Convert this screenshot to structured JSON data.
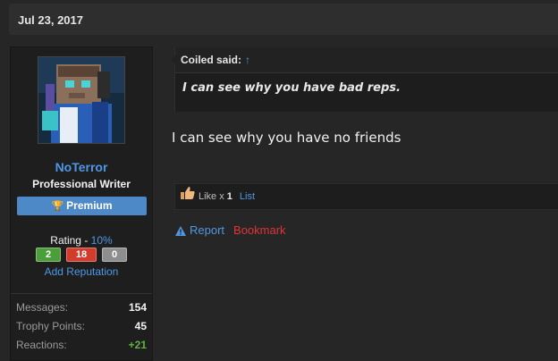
{
  "post": {
    "date": "Jul 23, 2017"
  },
  "author": {
    "username": "NoTerror",
    "title": "Professional Writer",
    "badge_label": "Premium",
    "rating_label": "Rating - ",
    "rating_percent": "10%",
    "rep_positive": "2",
    "rep_negative": "18",
    "rep_neutral": "0",
    "add_reputation": "Add Reputation",
    "stats": [
      {
        "label": "Messages:",
        "value": "154"
      },
      {
        "label": "Trophy Points:",
        "value": "45"
      },
      {
        "label": "Reactions:",
        "value": "+21"
      }
    ]
  },
  "quote": {
    "author_label": "Coiled said:",
    "arrow": "↑",
    "text": "I can see why you have bad reps."
  },
  "message": {
    "text": "I can see why you have no friends"
  },
  "likes": {
    "like_text": "Like x ",
    "count": "1",
    "list_label": "List"
  },
  "actions": {
    "report": "Report",
    "bookmark": "Bookmark"
  },
  "colors": {
    "accent": "#4f97e6",
    "premium": "#4d89c6",
    "positive": "#4c9e3b",
    "negative": "#d23c2d",
    "bookmark": "#e03434"
  },
  "icons": {
    "badge": "trophy-icon",
    "like": "thumbs-up-icon",
    "report": "warning-icon"
  }
}
